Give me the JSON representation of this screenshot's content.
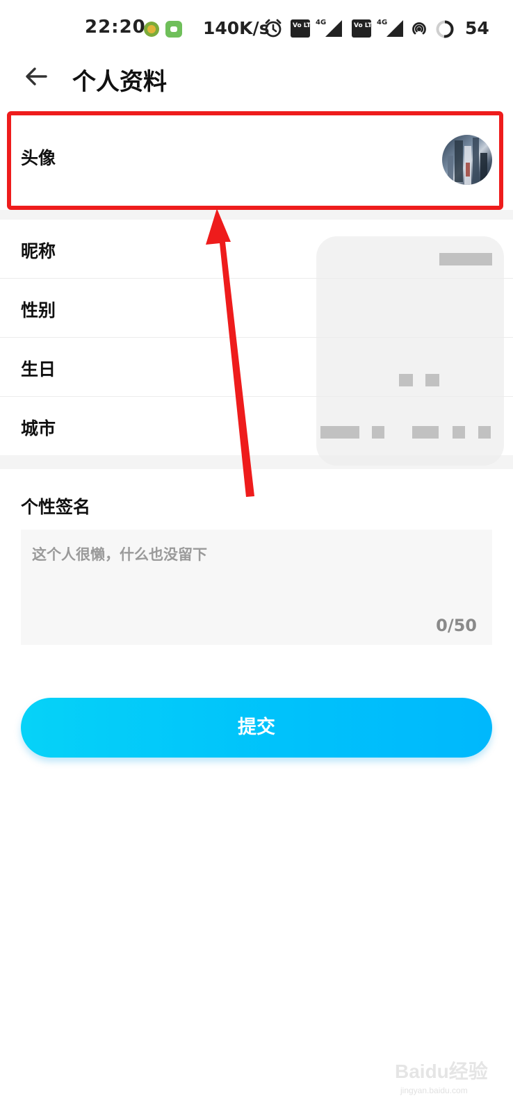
{
  "status_bar": {
    "time": "22:20",
    "net_speed": "140K/s",
    "network_1": "4G",
    "network_2": "4G",
    "volte_1": "Vo LTE",
    "volte_2": "Vo LTE",
    "battery_level": "54"
  },
  "header": {
    "title": "个人资料"
  },
  "profile": {
    "avatar_label": "头像",
    "nickname_label": "昵称",
    "gender_label": "性别",
    "birthday_label": "生日",
    "city_label": "城市"
  },
  "signature": {
    "title": "个性签名",
    "placeholder": "这个人很懒，什么也没留下",
    "count": "0/50"
  },
  "submit": {
    "label": "提交"
  },
  "annotation": {
    "highlight_color": "#ee1c1c",
    "arrow_color": "#ee1c1c"
  },
  "watermark": {
    "brand": "Baidu经验",
    "domain": "jingyan.baidu.com"
  },
  "colors": {
    "accent": "#00c2fb",
    "background": "#ffffff",
    "section_gap": "#f4f4f4"
  }
}
